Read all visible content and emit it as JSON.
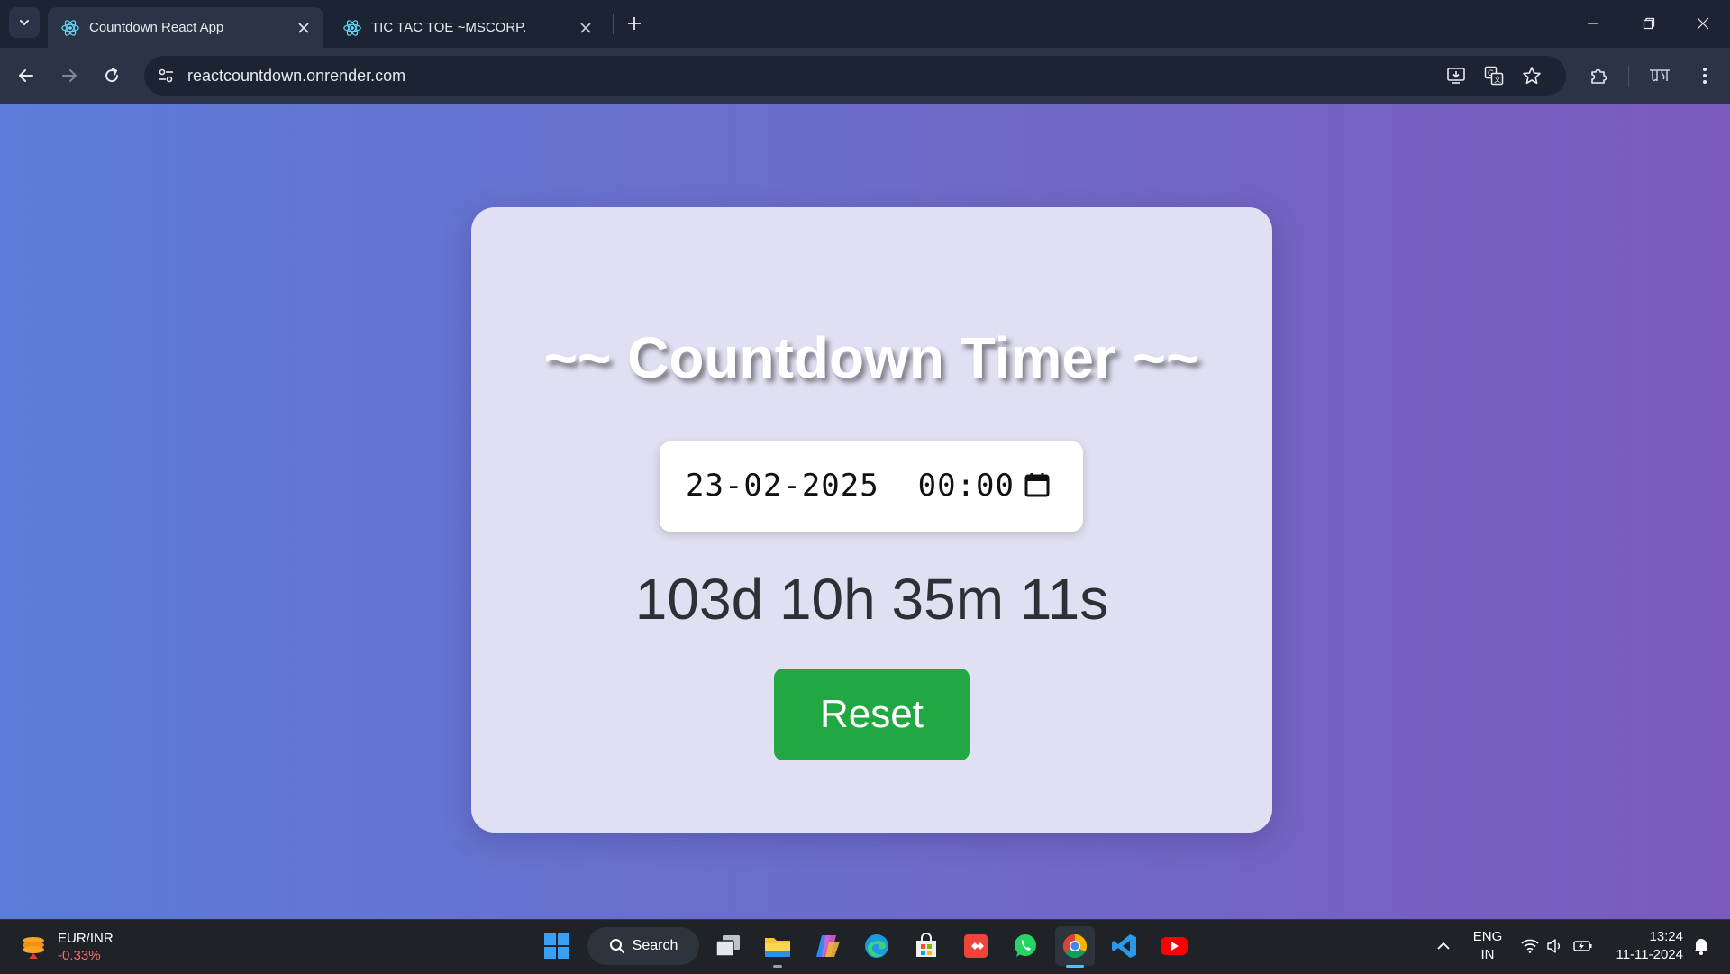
{
  "browser": {
    "tabs": [
      {
        "title": "Countdown React App",
        "active": true,
        "icon": "react-icon"
      },
      {
        "title": "TIC TAC TOE ~MSCORP.",
        "active": false,
        "icon": "react-icon"
      }
    ],
    "url": "reactcountdown.onrender.com"
  },
  "page": {
    "heading": "~~ Countdown Timer ~~",
    "datetime_value": "23-02-2025  00:00",
    "countdown": "103d 10h 35m 11s",
    "reset_label": "Reset"
  },
  "colors": {
    "gradient_start": "#5b7cd8",
    "gradient_end": "#7b5bbd",
    "card_bg": "#e0e0f2",
    "reset_green": "#22a843",
    "browser_chrome": "#2b3446"
  },
  "taskbar": {
    "widget": {
      "name": "EUR/INR",
      "change": "-0.33%"
    },
    "search_label": "Search",
    "apps": [
      "task-view-icon",
      "file-explorer-icon",
      "copilot-icon",
      "edge-icon",
      "microsoft-store-icon",
      "anydesk-icon",
      "whatsapp-icon",
      "chrome-icon",
      "vscode-icon",
      "youtube-icon"
    ],
    "language": {
      "line1": "ENG",
      "line2": "IN"
    },
    "clock": {
      "time": "13:24",
      "date": "11-11-2024"
    }
  }
}
